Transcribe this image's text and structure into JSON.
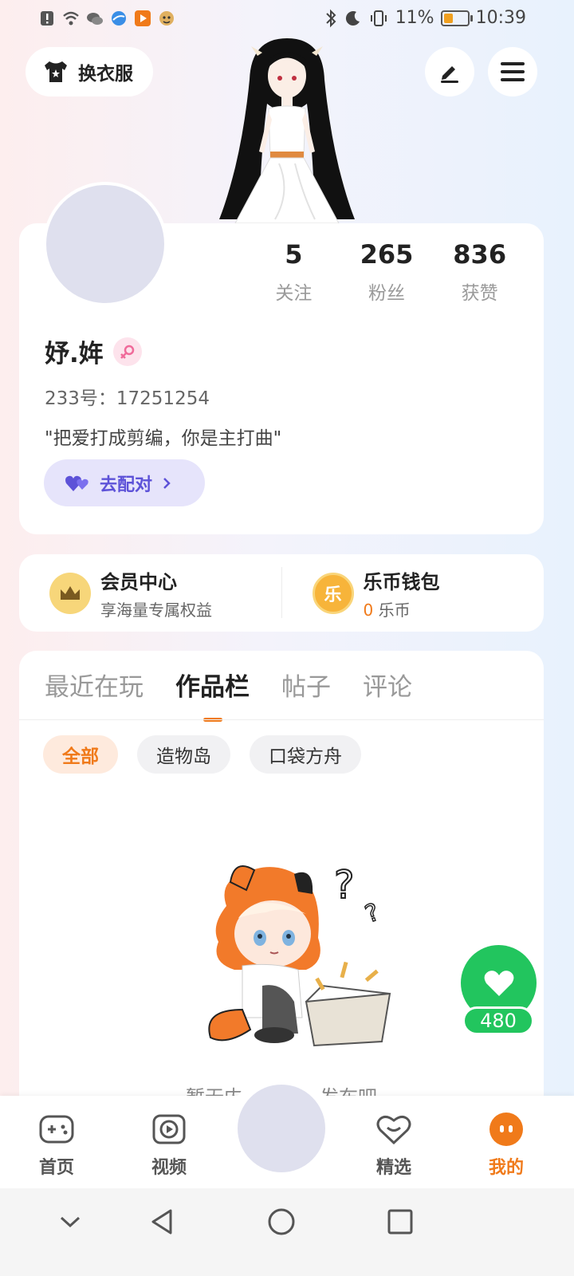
{
  "status_bar": {
    "battery_text": "11%",
    "battery_level": 0.11,
    "time": "10:39"
  },
  "top": {
    "outfit_label": "换衣服"
  },
  "profile": {
    "stats": [
      {
        "num": "5",
        "label": "关注"
      },
      {
        "num": "265",
        "label": "粉丝"
      },
      {
        "num": "836",
        "label": "获赞"
      }
    ],
    "username": "妤.姩",
    "gender_icon": "female-icon",
    "uid": "233号：17251254",
    "bio": "\"把爱打成剪编，你是主打曲\"",
    "match_label": "去配对"
  },
  "member": {
    "title": "会员中心",
    "subtitle": "享海量专属权益"
  },
  "wallet": {
    "icon_char": "乐",
    "title": "乐币钱包",
    "amount": "0",
    "unit": "乐币"
  },
  "works": {
    "tabs": [
      "最近在玩",
      "作品栏",
      "帖子",
      "评论"
    ],
    "active_tab": 1,
    "chips": [
      "全部",
      "造物岛",
      "口袋方舟"
    ],
    "empty_text": "暂无内容，快去发布吧"
  },
  "like": {
    "count": "480"
  },
  "bottom_nav": {
    "items": [
      {
        "label": "首页",
        "icon": "gamepad-icon"
      },
      {
        "label": "视频",
        "icon": "video-play-icon"
      },
      {
        "label": "精选",
        "icon": "heart-box-icon"
      },
      {
        "label": "我的",
        "icon": "me-face-icon"
      }
    ]
  },
  "colors": {
    "accent": "#f07a1a",
    "like_green": "#22c55e",
    "match_purple": "#5d52d8"
  }
}
